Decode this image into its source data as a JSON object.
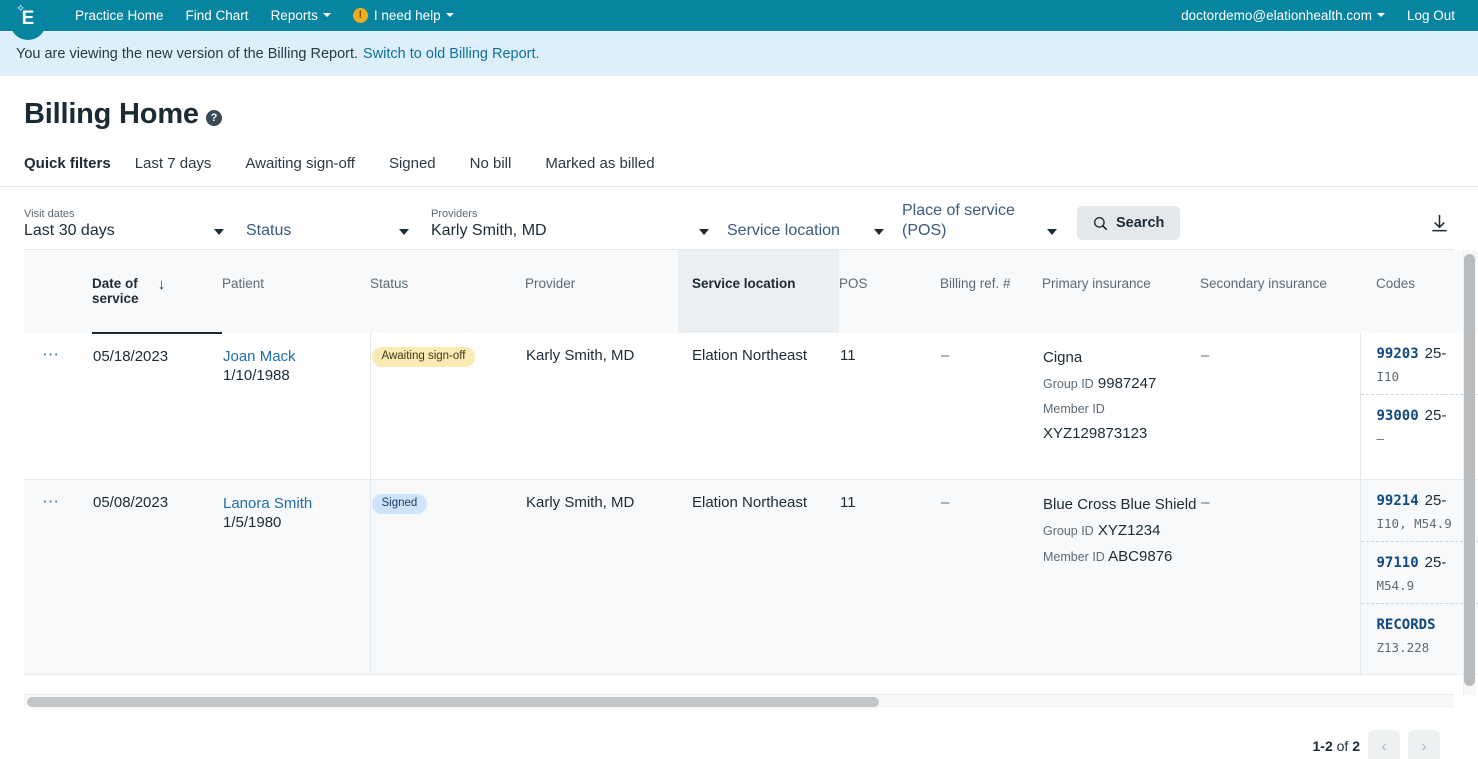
{
  "topnav": {
    "logo_icon": "elation-e-logo",
    "items": [
      {
        "label": "Practice Home",
        "caret": false,
        "icon": null
      },
      {
        "label": "Find Chart",
        "caret": false,
        "icon": null
      },
      {
        "label": "Reports",
        "caret": true,
        "icon": null
      },
      {
        "label": "I need help",
        "caret": true,
        "icon": "alert-exclamation-icon"
      }
    ],
    "account_email": "doctordemo@elationhealth.com",
    "logout_label": "Log Out"
  },
  "banner": {
    "text": "You are viewing the new version of the Billing Report.",
    "link_text": "Switch to old Billing Report."
  },
  "page": {
    "title": "Billing Home",
    "help_icon": "question-mark-circle-icon"
  },
  "quick_filters": {
    "label": "Quick filters",
    "items": [
      "Last 7 days",
      "Awaiting sign-off",
      "Signed",
      "No bill",
      "Marked as billed"
    ]
  },
  "filters": {
    "visit_dates": {
      "label": "Visit dates",
      "value": "Last 30 days"
    },
    "status": {
      "label": "Status",
      "placeholder": "Status",
      "value": ""
    },
    "providers": {
      "label": "Providers",
      "value": "Karly Smith, MD"
    },
    "service_location": {
      "label": "Service location",
      "placeholder": "Service location",
      "value": ""
    },
    "pos": {
      "label": "Place of service (POS)",
      "placeholder": "Place of service (POS)",
      "value": ""
    },
    "search_label": "Search",
    "search_icon": "search-icon",
    "download_icon": "download-icon"
  },
  "table": {
    "columns": [
      {
        "key": "actions",
        "label": ""
      },
      {
        "key": "date_of_service",
        "label": "Date of service",
        "sorted": true,
        "sort_icon": "arrow-down-icon"
      },
      {
        "key": "patient",
        "label": "Patient"
      },
      {
        "key": "status",
        "label": "Status"
      },
      {
        "key": "provider",
        "label": "Provider"
      },
      {
        "key": "service_location",
        "label": "Service location",
        "highlighted": true
      },
      {
        "key": "pos",
        "label": "POS"
      },
      {
        "key": "billing_ref",
        "label": "Billing ref. #"
      },
      {
        "key": "primary_insurance",
        "label": "Primary insurance"
      },
      {
        "key": "secondary_insurance",
        "label": "Secondary insurance"
      },
      {
        "key": "codes",
        "label": "Codes"
      }
    ],
    "rows": [
      {
        "actions_icon": "more-actions-icon",
        "date_of_service": "05/18/2023",
        "patient_name": "Joan Mack",
        "patient_dob": "1/10/1988",
        "status": "Awaiting sign-off",
        "status_kind": "awaiting",
        "provider": "Karly Smith, MD",
        "service_location": "Elation Northeast",
        "pos": "11",
        "billing_ref": "–",
        "primary_insurance": {
          "name": "Cigna",
          "group_id_label": "Group ID",
          "group_id": "9987247",
          "member_id_label": "Member ID",
          "member_id": "XYZ129873123",
          "stacked_member": true
        },
        "secondary_insurance": "–",
        "codes": [
          {
            "cpt": "99203",
            "modifier": "25-",
            "icd": "I10"
          },
          {
            "cpt": "93000",
            "modifier": "25-",
            "icd": "–"
          }
        ]
      },
      {
        "actions_icon": "more-actions-icon",
        "date_of_service": "05/08/2023",
        "patient_name": "Lanora Smith",
        "patient_dob": "1/5/1980",
        "status": "Signed",
        "status_kind": "signed",
        "provider": "Karly Smith, MD",
        "service_location": "Elation Northeast",
        "pos": "11",
        "billing_ref": "–",
        "primary_insurance": {
          "name": "Blue Cross Blue Shield",
          "group_id_label": "Group ID",
          "group_id": "XYZ1234",
          "member_id_label": "Member ID",
          "member_id": "ABC9876",
          "stacked_member": false
        },
        "secondary_insurance": "–",
        "codes": [
          {
            "cpt": "99214",
            "modifier": "25-",
            "icd": "I10, M54.9"
          },
          {
            "cpt": "97110",
            "modifier": "25-",
            "icd": "M54.9"
          },
          {
            "cpt": "RECORDS",
            "modifier": "",
            "icd": "Z13.228"
          }
        ]
      }
    ]
  },
  "pagination": {
    "range": "1-2",
    "of_word": "of",
    "total": "2",
    "prev_icon": "chevron-left-icon",
    "next_icon": "chevron-right-icon"
  },
  "colors": {
    "brand_teal": "#0784a0",
    "banner_blue": "#ddeffa",
    "link_blue": "#1f6fa8",
    "badge_awaiting": "#faeab3",
    "badge_signed": "#cfe4fb",
    "cpt_blue": "#11487e"
  }
}
